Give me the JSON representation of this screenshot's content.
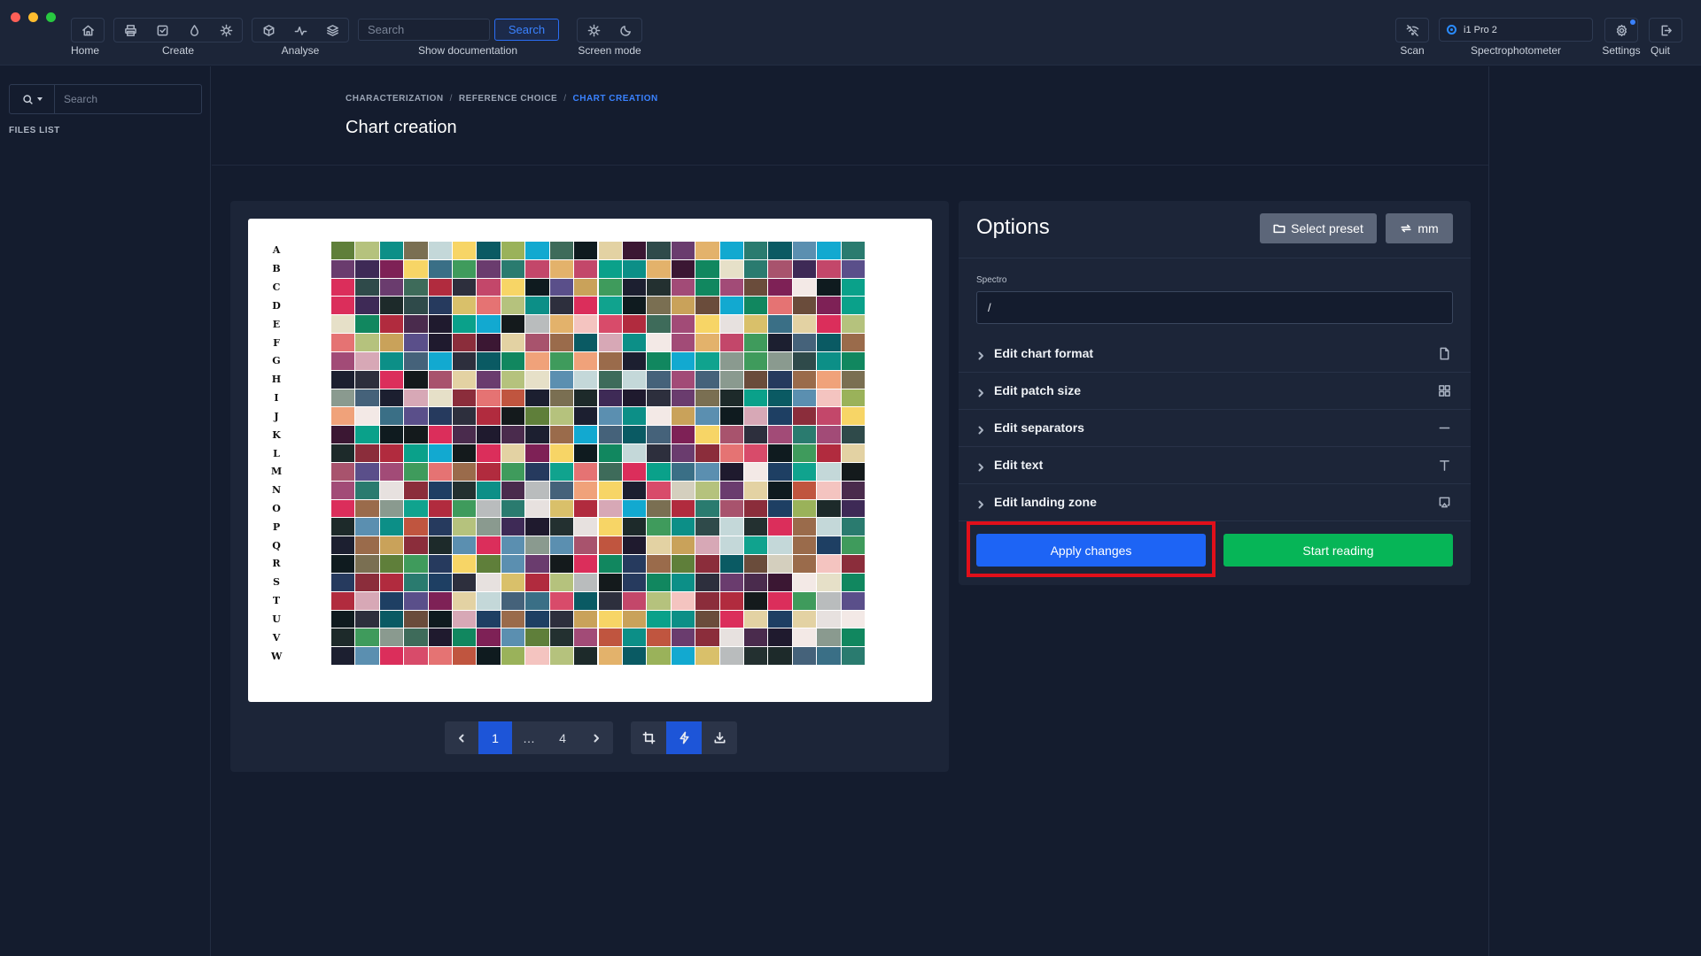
{
  "toolbar": {
    "home_label": "Home",
    "create_label": "Create",
    "analyse_label": "Analyse",
    "search_placeholder": "Search",
    "search_button": "Search",
    "doc_label": "Show documentation",
    "screen_mode_label": "Screen mode",
    "scan_label": "Scan",
    "device_name": "i1 Pro 2",
    "spectro_label": "Spectrophotometer",
    "settings_label": "Settings",
    "quit_label": "Quit"
  },
  "sidebar": {
    "search_placeholder": "Search",
    "files_list_label": "FILES LIST"
  },
  "breadcrumb": {
    "items": [
      "CHARACTERIZATION",
      "REFERENCE CHOICE",
      "CHART CREATION"
    ],
    "separator": "/"
  },
  "page": {
    "title": "Chart creation"
  },
  "chart": {
    "row_labels": [
      "A",
      "B",
      "C",
      "D",
      "E",
      "F",
      "G",
      "H",
      "I",
      "J",
      "K",
      "L",
      "M",
      "N",
      "O",
      "P",
      "Q",
      "R",
      "S",
      "T",
      "U",
      "V",
      "W"
    ],
    "columns": 22,
    "pager": {
      "pages": [
        "1",
        "…",
        "4"
      ],
      "current": "1"
    }
  },
  "options": {
    "title": "Options",
    "select_preset": "Select preset",
    "unit": "mm",
    "spectro_label": "Spectro",
    "spectro_value": "/",
    "rows": [
      {
        "label": "Edit chart format"
      },
      {
        "label": "Edit patch size"
      },
      {
        "label": "Edit separators"
      },
      {
        "label": "Edit text"
      },
      {
        "label": "Edit landing zone"
      }
    ],
    "apply_label": "Apply changes",
    "start_label": "Start reading"
  },
  "colors": {
    "accent": "#1d64f5",
    "success": "#06b557",
    "highlight": "#e10f1a",
    "background": "#141c2e",
    "panel": "#1c2538"
  },
  "icons": {
    "home": "home-icon",
    "print": "printer-icon",
    "checklist": "checkbox-icon",
    "drop": "drop-icon",
    "light": "sun-icon",
    "analyse_cube": "cube-icon",
    "pulse": "pulse-icon",
    "layers": "layers-icon",
    "sun": "sun-icon",
    "moon": "moon-icon",
    "scan": "wifi-off-icon",
    "settings": "gear-icon",
    "quit": "logout-icon"
  }
}
